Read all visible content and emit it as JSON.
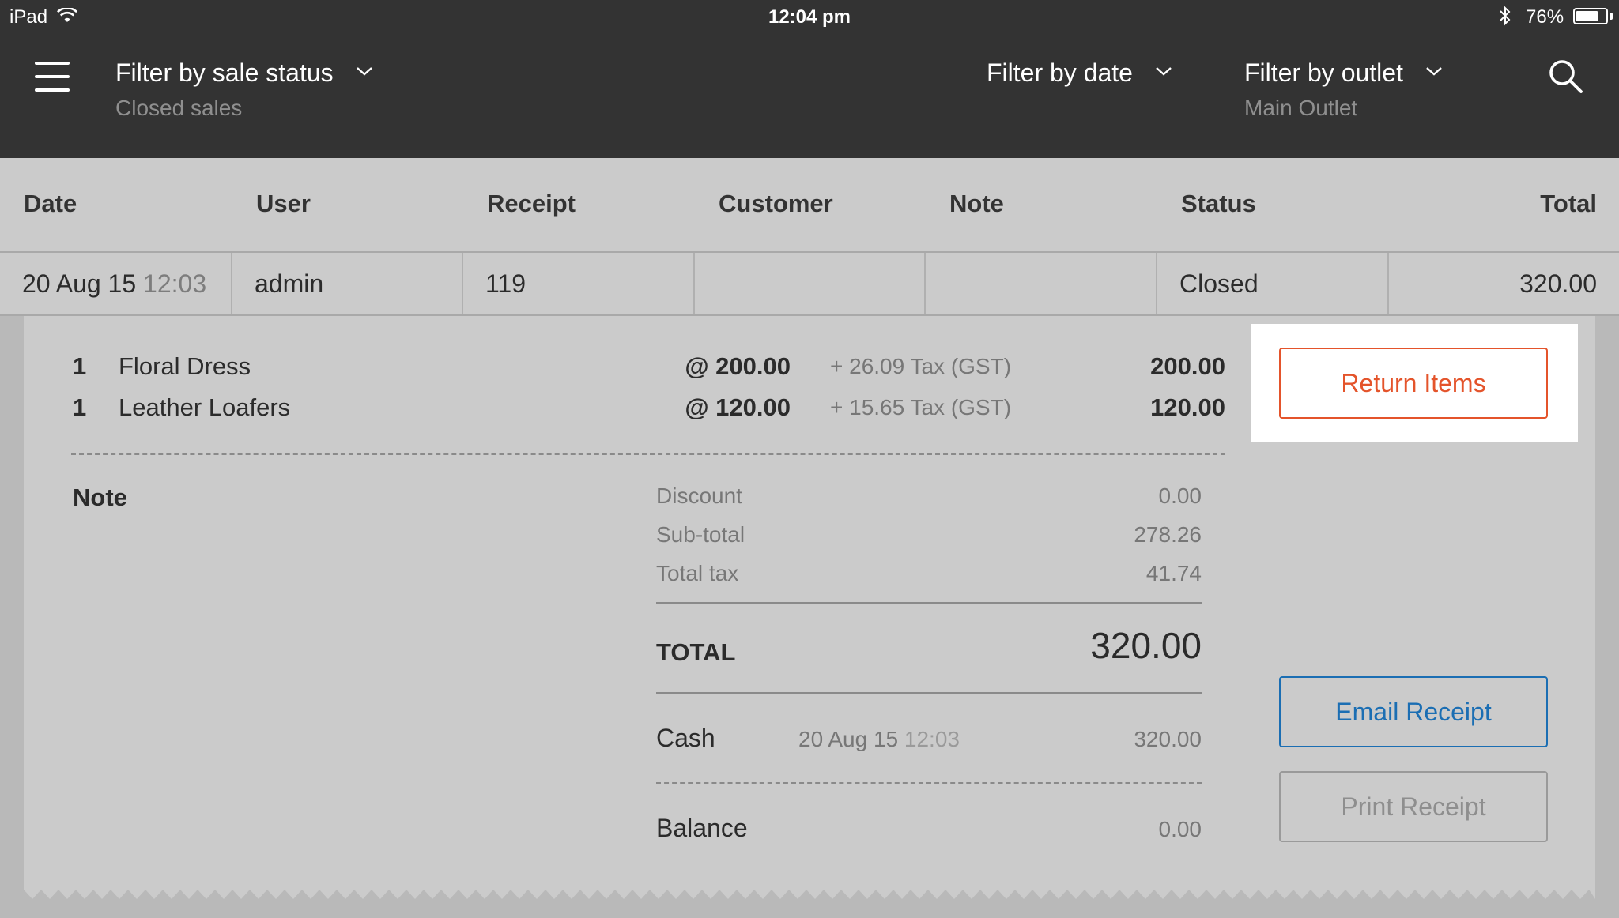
{
  "statusbar": {
    "device": "iPad",
    "time": "12:04 pm",
    "battery_text": "76%",
    "battery_level": 0.76
  },
  "header": {
    "filter_status": {
      "label": "Filter by sale status",
      "value": "Closed sales"
    },
    "filter_date": {
      "label": "Filter by date"
    },
    "filter_outlet": {
      "label": "Filter by outlet",
      "value": "Main Outlet"
    }
  },
  "table": {
    "columns": [
      "Date",
      "User",
      "Receipt",
      "Customer",
      "Note",
      "Status",
      "Total"
    ],
    "row": {
      "date": "20 Aug 15",
      "time": "12:03",
      "user": "admin",
      "receipt": "119",
      "customer": "",
      "note": "",
      "status": "Closed",
      "total": "320.00"
    }
  },
  "receipt": {
    "items": [
      {
        "qty": "1",
        "name": "Floral Dress",
        "price": "@ 200.00",
        "tax": "+ 26.09 Tax (GST)",
        "total": "200.00"
      },
      {
        "qty": "1",
        "name": "Leather Loafers",
        "price": "@ 120.00",
        "tax": "+ 15.65 Tax (GST)",
        "total": "120.00"
      }
    ],
    "note_label": "Note",
    "summary": {
      "discount_label": "Discount",
      "discount": "0.00",
      "subtotal_label": "Sub-total",
      "subtotal": "278.26",
      "tax_label": "Total tax",
      "tax": "41.74"
    },
    "total_label": "TOTAL",
    "total": "320.00",
    "payment": {
      "method": "Cash",
      "date": "20 Aug 15",
      "time": "12:03",
      "amount": "320.00"
    },
    "balance_label": "Balance",
    "balance": "0.00"
  },
  "actions": {
    "return_label": "Return Items",
    "email_label": "Email Receipt",
    "print_label": "Print Receipt"
  },
  "colors": {
    "header_bg": "#333333",
    "panel_bg": "#cbcbcb",
    "return_accent": "#e4542b",
    "email_accent": "#1b6eb3"
  }
}
